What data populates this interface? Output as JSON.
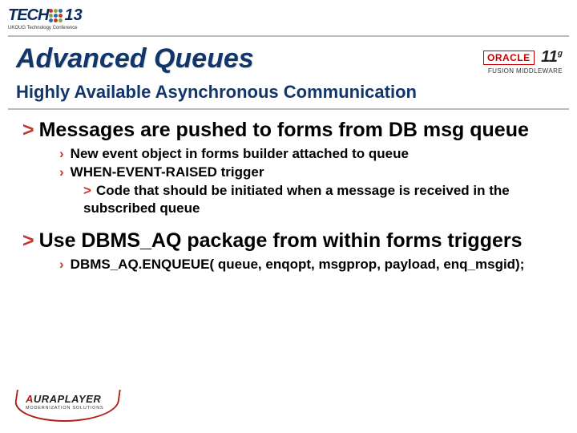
{
  "logo": {
    "tech": "TECH",
    "thirteen": "13",
    "sub": "UKOUG Technology Conference"
  },
  "oracle": {
    "brand": "ORACLE",
    "version": "11",
    "suffix": "g",
    "line2": "FUSION MIDDLEWARE"
  },
  "title": "Advanced Queues",
  "subtitle": "Highly Available Asynchronous Communication",
  "bullets": {
    "b1": "Messages are pushed to forms from DB msg queue",
    "b1_1": "New event object in forms builder attached to queue",
    "b1_2": "WHEN-EVENT-RAISED trigger",
    "b1_2_1": "Code that should be initiated when a message is received in the subscribed queue",
    "b2": "Use DBMS_AQ package from within forms triggers",
    "b2_1": "DBMS_AQ.ENQUEUE( queue, enqopt, msgprop, payload, enq_msgid);"
  },
  "footer": {
    "brand_a": "A",
    "brand_rest": "URAPLAYER",
    "sub": "MODERNIZATION SOLUTIONS"
  }
}
